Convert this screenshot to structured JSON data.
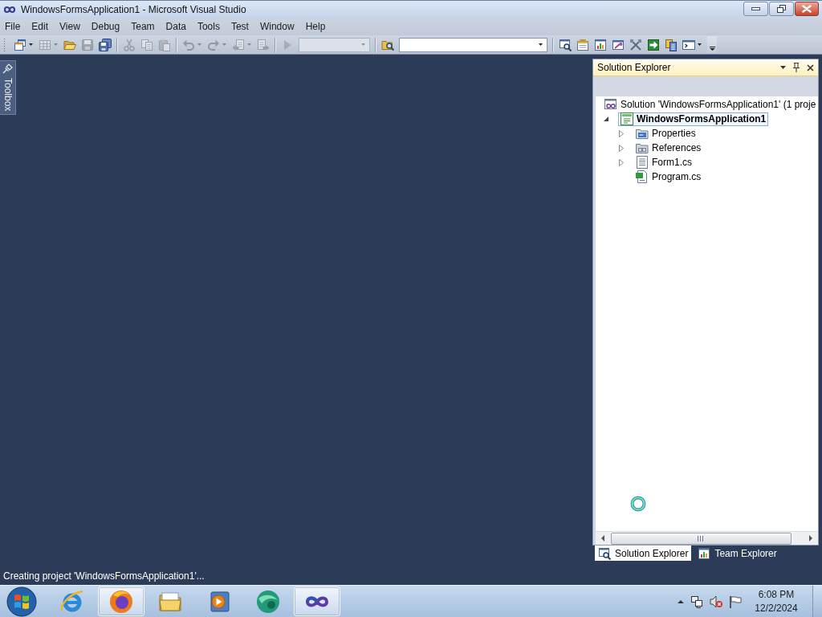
{
  "window": {
    "title": "WindowsFormsApplication1 - Microsoft Visual Studio"
  },
  "menu": [
    "File",
    "Edit",
    "View",
    "Debug",
    "Team",
    "Data",
    "Tools",
    "Test",
    "Window",
    "Help"
  ],
  "toolbar": {
    "groups": [
      {
        "items": [
          {
            "kind": "split",
            "disabled": false
          },
          {
            "kind": "split",
            "disabled": true
          },
          {
            "kind": "button",
            "disabled": false
          },
          {
            "kind": "button",
            "disabled": true
          },
          {
            "kind": "button",
            "disabled": false
          }
        ]
      },
      {
        "items": [
          {
            "kind": "button",
            "disabled": true
          },
          {
            "kind": "button",
            "disabled": true
          },
          {
            "kind": "button",
            "disabled": true
          }
        ]
      },
      {
        "items": [
          {
            "kind": "split",
            "disabled": true
          },
          {
            "kind": "split",
            "disabled": true
          },
          {
            "kind": "split",
            "disabled": true
          },
          {
            "kind": "button",
            "disabled": true
          }
        ]
      },
      {
        "items": [
          {
            "kind": "button",
            "disabled": true
          },
          {
            "kind": "combo",
            "disabled": true
          }
        ]
      },
      {
        "items": [
          {
            "kind": "button",
            "disabled": false
          },
          {
            "kind": "combo",
            "disabled": false
          }
        ]
      },
      {
        "items": [
          {
            "kind": "button",
            "disabled": false
          },
          {
            "kind": "button",
            "disabled": false
          },
          {
            "kind": "button",
            "disabled": false
          },
          {
            "kind": "button",
            "disabled": false
          },
          {
            "kind": "button",
            "disabled": false
          },
          {
            "kind": "button",
            "disabled": false
          },
          {
            "kind": "button",
            "disabled": false
          },
          {
            "kind": "split",
            "disabled": false
          }
        ]
      }
    ]
  },
  "toolbox_tab": {
    "label": "Toolbox"
  },
  "solution_explorer": {
    "title": "Solution Explorer",
    "tree": [
      {
        "kind": "solution",
        "label": "Solution 'WindowsFormsApplication1' (1 proje",
        "selected": false,
        "children": [
          {
            "kind": "project",
            "label": "WindowsFormsApplication1",
            "expanded": true,
            "selected": true,
            "children": [
              {
                "kind": "properties",
                "label": "Properties",
                "expanded": false,
                "selected": false
              },
              {
                "kind": "references",
                "label": "References",
                "expanded": false,
                "selected": false
              },
              {
                "kind": "form",
                "label": "Form1.cs",
                "expanded": false,
                "selected": false
              },
              {
                "kind": "code",
                "label": "Program.cs",
                "selected": false
              }
            ]
          }
        ]
      }
    ],
    "tabs": [
      {
        "label": "Solution Explorer",
        "selected": true
      },
      {
        "label": "Team Explorer",
        "selected": false
      }
    ]
  },
  "status_bar": {
    "text": "Creating project 'WindowsFormsApplication1'..."
  },
  "taskbar": {
    "apps": [
      {
        "kind": "ring",
        "running": false
      },
      {
        "kind": "globe",
        "running": true
      },
      {
        "kind": "folder",
        "running": false
      },
      {
        "kind": "player",
        "running": false
      },
      {
        "kind": "sphere",
        "running": false
      },
      {
        "kind": "infinity",
        "running": true
      }
    ],
    "clock": {
      "time": "6:08 PM",
      "date": "12/2/2024"
    }
  }
}
